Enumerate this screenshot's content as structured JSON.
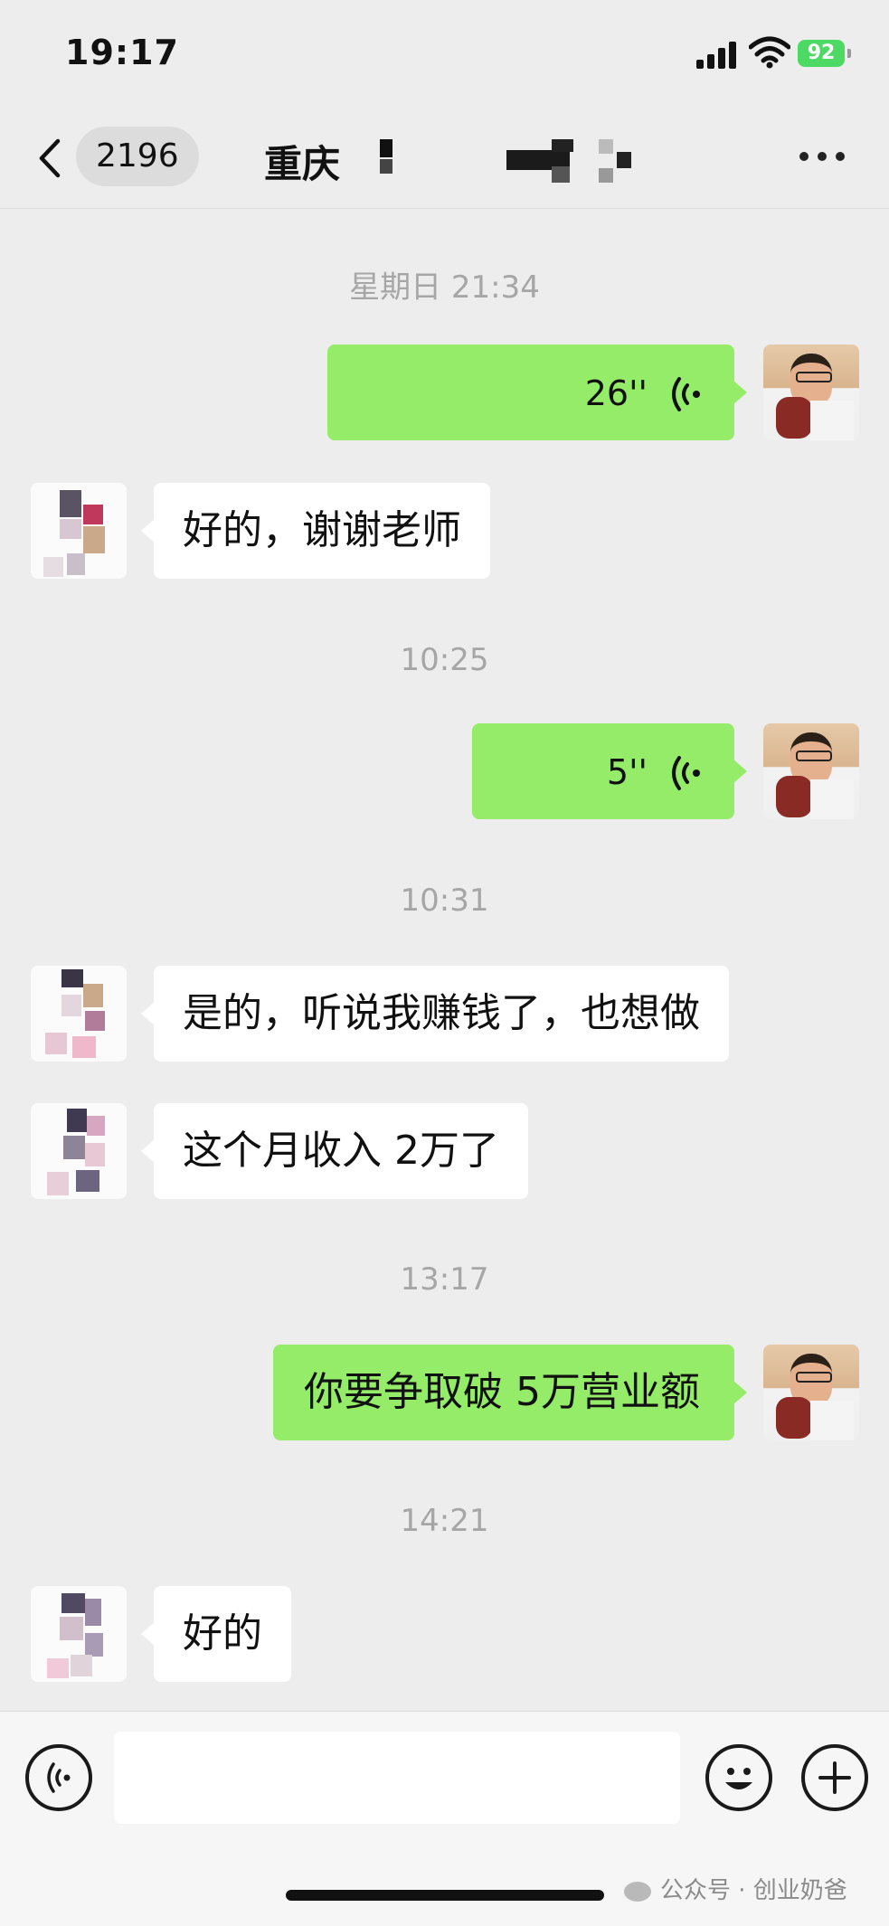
{
  "status_bar": {
    "time": "19:17",
    "battery": "92"
  },
  "header": {
    "unread_count": "2196",
    "title": "重庆"
  },
  "messages": [
    {
      "type": "timestamp",
      "text": "星期日 21:34"
    },
    {
      "type": "voice",
      "from": "me",
      "duration": "26''"
    },
    {
      "type": "text",
      "from": "other",
      "text": "好的，谢谢老师"
    },
    {
      "type": "timestamp",
      "text": "10:25"
    },
    {
      "type": "voice",
      "from": "me",
      "duration": "5''"
    },
    {
      "type": "timestamp",
      "text": "10:31"
    },
    {
      "type": "text",
      "from": "other",
      "text": "是的，听说我赚钱了，也想做"
    },
    {
      "type": "text",
      "from": "other",
      "text": "这个月收入 2万了"
    },
    {
      "type": "timestamp",
      "text": "13:17"
    },
    {
      "type": "text",
      "from": "me",
      "text": "你要争取破 5万营业额"
    },
    {
      "type": "timestamp",
      "text": "14:21"
    },
    {
      "type": "text",
      "from": "other",
      "text": "好的"
    }
  ],
  "input": {
    "value": ""
  },
  "watermark": "公众号 · 创业奶爸",
  "colors": {
    "my_bubble": "#95ec69",
    "other_bubble": "#ffffff",
    "background": "#ededed"
  },
  "icons": [
    "back-arrow-icon",
    "more-icon",
    "voice-wave-icon",
    "voice-input-icon",
    "emoji-icon",
    "add-icon",
    "signal-icon",
    "wifi-icon",
    "battery-icon"
  ]
}
